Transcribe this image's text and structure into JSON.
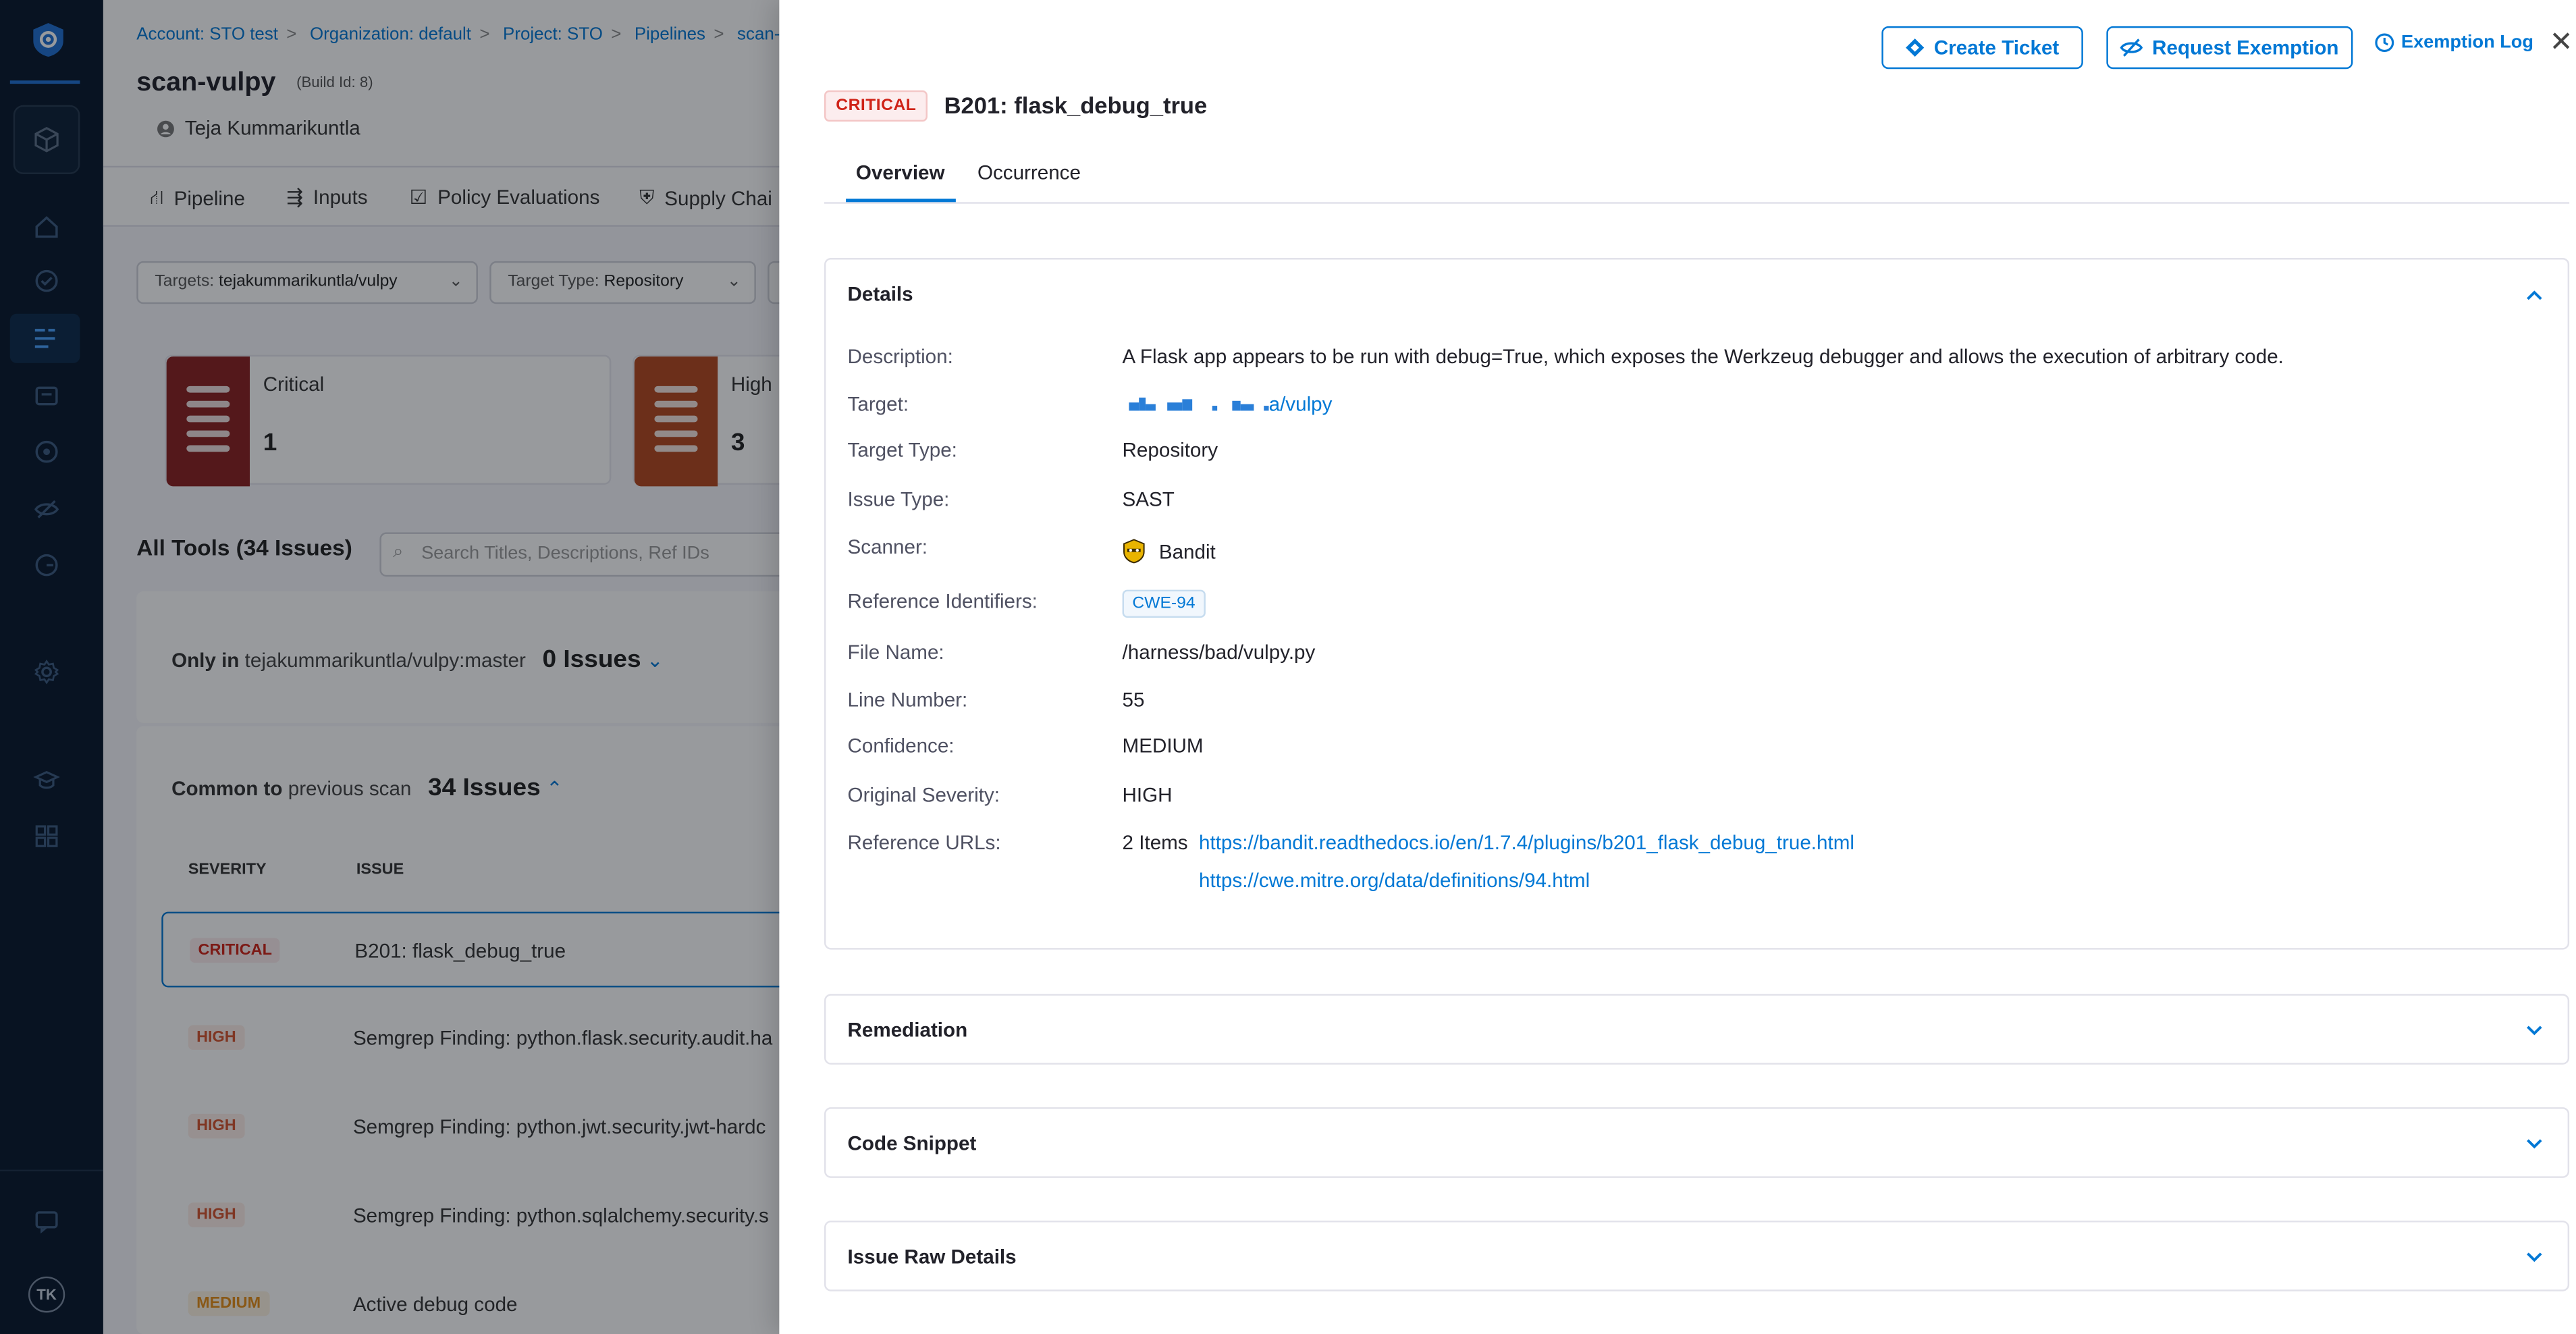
{
  "background": {
    "breadcrumbs": [
      "Account: STO test",
      "Organization: default",
      "Project: STO",
      "Pipelines",
      "scan-v"
    ],
    "title": "scan-vulpy",
    "build_id": "(Build Id: 8)",
    "user": "Teja Kummarikuntla",
    "tabs": [
      "Pipeline",
      "Inputs",
      "Policy Evaluations",
      "Supply Chai"
    ],
    "filters": {
      "targets_label": "Targets:",
      "targets_value": "tejakummarikuntla/vulpy",
      "type_label": "Target Type:",
      "type_value": "Repository"
    },
    "severity_cards": [
      {
        "label": "Critical",
        "count": "1",
        "color": "#8b1f1f"
      },
      {
        "label": "High",
        "count": "3",
        "color": "#b4481e"
      }
    ],
    "all_tools": "All Tools (34 Issues)",
    "search_placeholder": "Search Titles, Descriptions, Ref IDs",
    "only_in": {
      "prefix": "Only in",
      "target": "tejakummarikuntla/vulpy:master",
      "count": "0 Issues"
    },
    "common": {
      "prefix": "Common to",
      "suffix": "previous scan",
      "count": "34 Issues"
    },
    "table_headers": {
      "severity": "SEVERITY",
      "issue": "ISSUE"
    },
    "rows": [
      {
        "severity": "CRITICAL",
        "issue": "B201: flask_debug_true"
      },
      {
        "severity": "HIGH",
        "issue": "Semgrep Finding: python.flask.security.audit.ha"
      },
      {
        "severity": "HIGH",
        "issue": "Semgrep Finding: python.jwt.security.jwt-hardc"
      },
      {
        "severity": "HIGH",
        "issue": "Semgrep Finding: python.sqlalchemy.security.s"
      },
      {
        "severity": "MEDIUM",
        "issue": "Active debug code"
      }
    ],
    "avatar_initials": "TK"
  },
  "drawer": {
    "actions": {
      "create_ticket": "Create Ticket",
      "request_exemption": "Request Exemption",
      "exemption_log": "Exemption Log"
    },
    "severity_badge": "CRITICAL",
    "title": "B201: flask_debug_true",
    "tabs": [
      "Overview",
      "Occurrence"
    ],
    "details": {
      "title": "Details",
      "description_label": "Description:",
      "description": "A Flask app appears to be run with debug=True, which exposes the Werkzeug debugger and allows the execution of arbitrary code.",
      "target_label": "Target:",
      "target": "a/vulpy",
      "target_type_label": "Target Type:",
      "target_type": "Repository",
      "issue_type_label": "Issue Type:",
      "issue_type": "SAST",
      "scanner_label": "Scanner:",
      "scanner": "Bandit",
      "ref_ids_label": "Reference Identifiers:",
      "ref_id": "CWE-94",
      "file_name_label": "File Name:",
      "file_name": "/harness/bad/vulpy.py",
      "line_number_label": "Line Number:",
      "line_number": "55",
      "confidence_label": "Confidence:",
      "confidence": "MEDIUM",
      "original_severity_label": "Original Severity:",
      "original_severity": "HIGH",
      "ref_urls_label": "Reference URLs:",
      "ref_urls_count": "2 Items",
      "ref_urls": [
        "https://bandit.readthedocs.io/en/1.7.4/plugins/b201_flask_debug_true.html",
        "https://cwe.mitre.org/data/definitions/94.html"
      ]
    },
    "sections": [
      "Remediation",
      "Code Snippet",
      "Issue Raw Details"
    ]
  },
  "colors": {
    "accent": "#0278d5",
    "critical": "#cf2318",
    "high": "#d4532e",
    "medium": "#e58d18",
    "nav_bg": "#07182b"
  }
}
